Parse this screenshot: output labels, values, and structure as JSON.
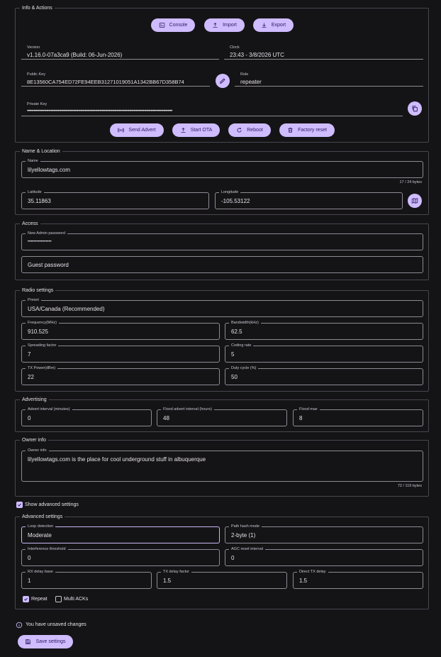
{
  "info": {
    "title": "Info & Actions",
    "buttons": {
      "console": "Console",
      "import": "Import",
      "export": "Export"
    },
    "version_label": "Version",
    "version_value": "v1.16.0-07a3ca9 (Build: 06-Jun-2026)",
    "clock_label": "Clock",
    "clock_value": "23:43 - 3/8/2026 UTC",
    "pubkey_label": "Public Key",
    "pubkey_value": "8E13560CA754ED72FE94EEB31271019051A1342BB67D358B74",
    "role_label": "Role",
    "role_value": "repeater",
    "privkey_label": "Private Key",
    "privkey_value": "••••••••••••••••••••••••••••••••••••••••••••••••••••••••••••••••••••••••••••••••••••••••••••••••••••••••••••••••••••••••••••••••",
    "actions": {
      "send_advert": "Send Advert",
      "start_ota": "Start OTA",
      "reboot": "Reboot",
      "factory_reset": "Factory reset"
    }
  },
  "name_location": {
    "title": "Name & Location",
    "name_label": "Name",
    "name_value": "lilyellowtags.com",
    "name_counter": "17 / 24 bytes",
    "lat_label": "Latitude",
    "lat_value": "35.11863",
    "lon_label": "Longitude",
    "lon_value": "-105.53122"
  },
  "access": {
    "title": "Access",
    "admin_label": "New Admin password",
    "admin_value": "••••••••••••••••",
    "guest_placeholder": "Guest password"
  },
  "radio": {
    "title": "Radio settings",
    "preset_label": "Preset",
    "preset_value": "USA/Canada (Recommended)",
    "freq_label": "Frequency(MHz)",
    "freq_value": "910.525",
    "bw_label": "Bandwidth(kHz)",
    "bw_value": "62.5",
    "sf_label": "Spreading factor",
    "sf_value": "7",
    "cr_label": "Coding rate",
    "cr_value": "5",
    "tx_label": "TX Power(dBm)",
    "tx_value": "22",
    "duty_label": "Duty cycle (%)",
    "duty_value": "50"
  },
  "advertising": {
    "title": "Advertising",
    "interval_label": "Advert interval (minutes)",
    "interval_value": "0",
    "flood_interval_label": "Flood advert interval (hours)",
    "flood_interval_value": "48",
    "flood_max_label": "Flood max",
    "flood_max_value": "8"
  },
  "owner": {
    "title": "Owner info",
    "label": "Owner info",
    "value": "lilyellowtags.com is the place for cool underground stuff in albuquerque",
    "counter": "72 / 119 bytes"
  },
  "show_advanced": {
    "label": "Show advanced settings",
    "checked": true
  },
  "advanced": {
    "title": "Advanced settings",
    "loop_label": "Loop detection",
    "loop_value": "Moderate",
    "path_label": "Path hash mode",
    "path_value": "2-byte (1)",
    "interf_label": "Interference threshold",
    "interf_value": "0",
    "agc_label": "AGC reset interval",
    "agc_value": "0",
    "rx_label": "RX delay base",
    "rx_value": "1",
    "txf_label": "TX delay factor",
    "txf_value": "1.5",
    "dtx_label": "Direct TX delay",
    "dtx_value": "1.5",
    "repeat_label": "Repeat",
    "repeat_checked": true,
    "multi_label": "Multi ACKs",
    "multi_checked": false
  },
  "footer": {
    "unsaved": "You have unsaved changes",
    "save": "Save settings"
  },
  "colors": {
    "accent": "#cfbcff",
    "on_accent": "#2e1a62",
    "background": "#141416",
    "outline": "#8e8a94"
  }
}
